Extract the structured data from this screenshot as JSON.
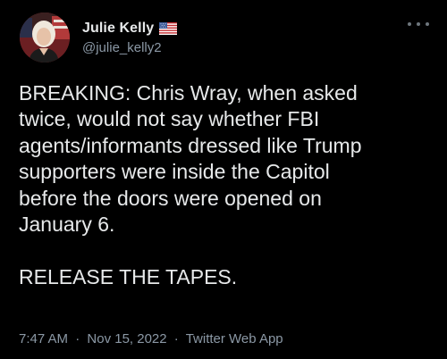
{
  "author": {
    "display_name": "Julie Kelly",
    "handle": "@julie_kelly2",
    "flag_icon": "us-flag-icon"
  },
  "tweet": {
    "text": "BREAKING: Chris Wray, when asked\ntwice, would not say whether FBI\nagents/informants dressed like Trump\nsupporters were inside the Capitol\nbefore the doors were opened on\nJanuary 6.\n\nRELEASE THE TAPES.",
    "time": "7:47 AM",
    "separator": "·",
    "date": "Nov 15, 2022",
    "source": "Twitter Web App"
  },
  "colors": {
    "background": "#000000",
    "text_primary": "#e7e9ea",
    "text_secondary": "#8b98a5"
  },
  "icons": {
    "more": "more-options-icon",
    "avatar": "avatar"
  }
}
